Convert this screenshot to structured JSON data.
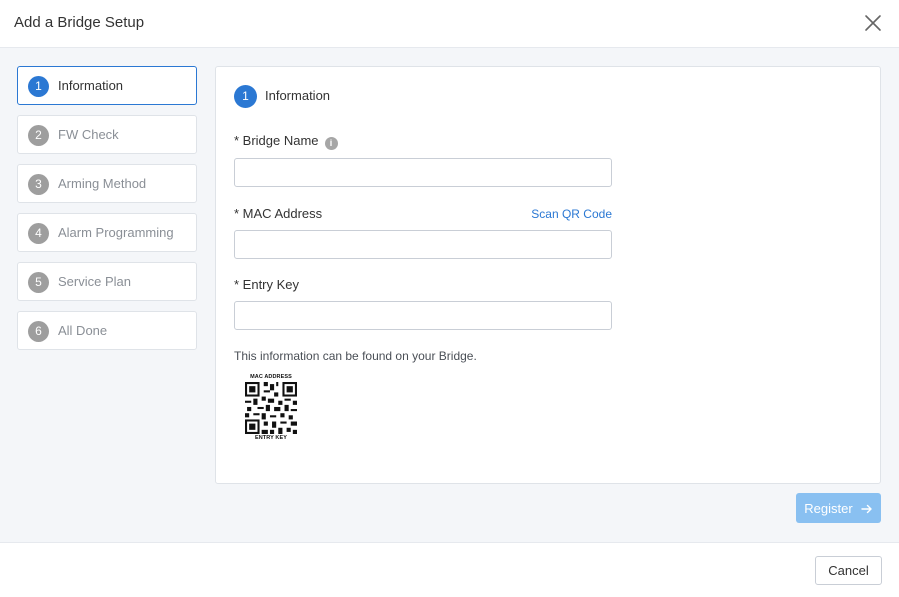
{
  "dialog": {
    "title": "Add a Bridge Setup"
  },
  "steps": [
    {
      "num": "1",
      "label": "Information"
    },
    {
      "num": "2",
      "label": "FW Check"
    },
    {
      "num": "3",
      "label": "Arming Method"
    },
    {
      "num": "4",
      "label": "Alarm Programming"
    },
    {
      "num": "5",
      "label": "Service Plan"
    },
    {
      "num": "6",
      "label": "All Done"
    }
  ],
  "panel": {
    "step_num": "1",
    "step_label": "Information",
    "bridge_name_label": "* Bridge Name",
    "bridge_name_value": "",
    "mac_label": "* MAC Address",
    "mac_value": "",
    "scan_link": "Scan QR Code",
    "entry_key_label": "* Entry Key",
    "entry_key_value": "",
    "hint": "This information can be found on your Bridge.",
    "qr_top": "MAC ADDRESS",
    "qr_bottom": "ENTRY KEY",
    "info_icon": "i"
  },
  "actions": {
    "register_label": "Register",
    "cancel_label": "Cancel"
  },
  "colors": {
    "accent": "#2b78d3",
    "register_disabled": "#89c0f1",
    "step_inactive": "#9e9e9e"
  }
}
